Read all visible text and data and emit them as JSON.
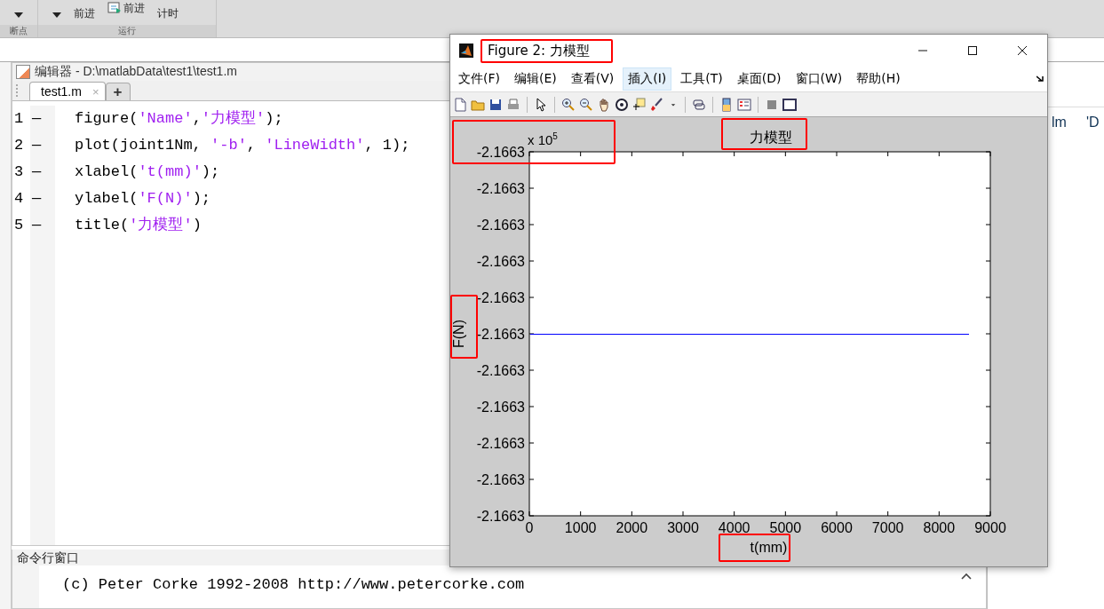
{
  "toolstrip": {
    "buttons": [
      {
        "label": "前进",
        "kind": "caret-label"
      },
      {
        "label": "前进",
        "kind": "icon-label"
      },
      {
        "label": "计时",
        "kind": "label"
      }
    ],
    "groups": [
      "断点",
      "运行"
    ]
  },
  "editor": {
    "title": "编辑器 - D:\\matlabData\\test1\\test1.m",
    "tabs": [
      {
        "label": "test1.m",
        "close": "×",
        "selected": true
      }
    ],
    "add_tab": "+",
    "lines": [
      {
        "number": "1",
        "marker": "—",
        "segments": [
          {
            "kind": "code",
            "text": "figure("
          },
          {
            "kind": "string",
            "text": "'Name'"
          },
          {
            "kind": "code",
            "text": ","
          },
          {
            "kind": "string",
            "text": "'力模型'"
          },
          {
            "kind": "code",
            "text": ");"
          }
        ]
      },
      {
        "number": "2",
        "marker": "—",
        "segments": [
          {
            "kind": "code",
            "text": "plot(joint1Nm, "
          },
          {
            "kind": "string",
            "text": "'-b'"
          },
          {
            "kind": "code",
            "text": ", "
          },
          {
            "kind": "string",
            "text": "'LineWidth'"
          },
          {
            "kind": "code",
            "text": ", 1);"
          }
        ]
      },
      {
        "number": "3",
        "marker": "—",
        "segments": [
          {
            "kind": "code",
            "text": "xlabel("
          },
          {
            "kind": "string",
            "text": "'t(mm)'"
          },
          {
            "kind": "code",
            "text": ");"
          }
        ]
      },
      {
        "number": "4",
        "marker": "—",
        "segments": [
          {
            "kind": "code",
            "text": "ylabel("
          },
          {
            "kind": "string",
            "text": "'F(N)'"
          },
          {
            "kind": "code",
            "text": ");"
          }
        ]
      },
      {
        "number": "5",
        "marker": "—",
        "segments": [
          {
            "kind": "code",
            "text": "title("
          },
          {
            "kind": "string",
            "text": "'力模型'"
          },
          {
            "kind": "code",
            "text": ")"
          }
        ]
      }
    ]
  },
  "command_window": {
    "title": "命令行窗口",
    "lines": [
      "(c) Peter Corke 1992-2008 http://www.petercorke.com"
    ]
  },
  "workspace": {
    "cells": [
      "lm",
      "'D"
    ]
  },
  "figure": {
    "title": "Figure 2: 力模型",
    "title_boxed": true,
    "menu": [
      {
        "label": "文件(F)",
        "selected": false
      },
      {
        "label": "编辑(E)",
        "selected": false
      },
      {
        "label": "查看(V)",
        "selected": false
      },
      {
        "label": "插入(I)",
        "selected": true
      },
      {
        "label": "工具(T)",
        "selected": false
      },
      {
        "label": "桌面(D)",
        "selected": false
      },
      {
        "label": "窗口(W)",
        "selected": false
      },
      {
        "label": "帮助(H)",
        "selected": false
      }
    ],
    "exponent": "x 10$^{5}$",
    "exponent_boxed": true,
    "title_label_boxed": true,
    "ylabel_boxed": true,
    "xlabel_boxed": true,
    "plot": {
      "title": "力模型",
      "xlabel": "t(mm)",
      "ylabel": "F(N)"
    },
    "x_tick_labels": [
      "0",
      "1000",
      "2000",
      "3000",
      "4000",
      "5000",
      "6000",
      "7000",
      "8000",
      "9000"
    ],
    "y_tick_labels": [
      "-2.1663",
      "-2.1663",
      "-2.1663",
      "-2.1663",
      "-2.1663",
      "-2.1663",
      "-2.1663",
      "-2.1663",
      "-2.1663",
      "-2.1663",
      "-2.1663"
    ]
  }
}
